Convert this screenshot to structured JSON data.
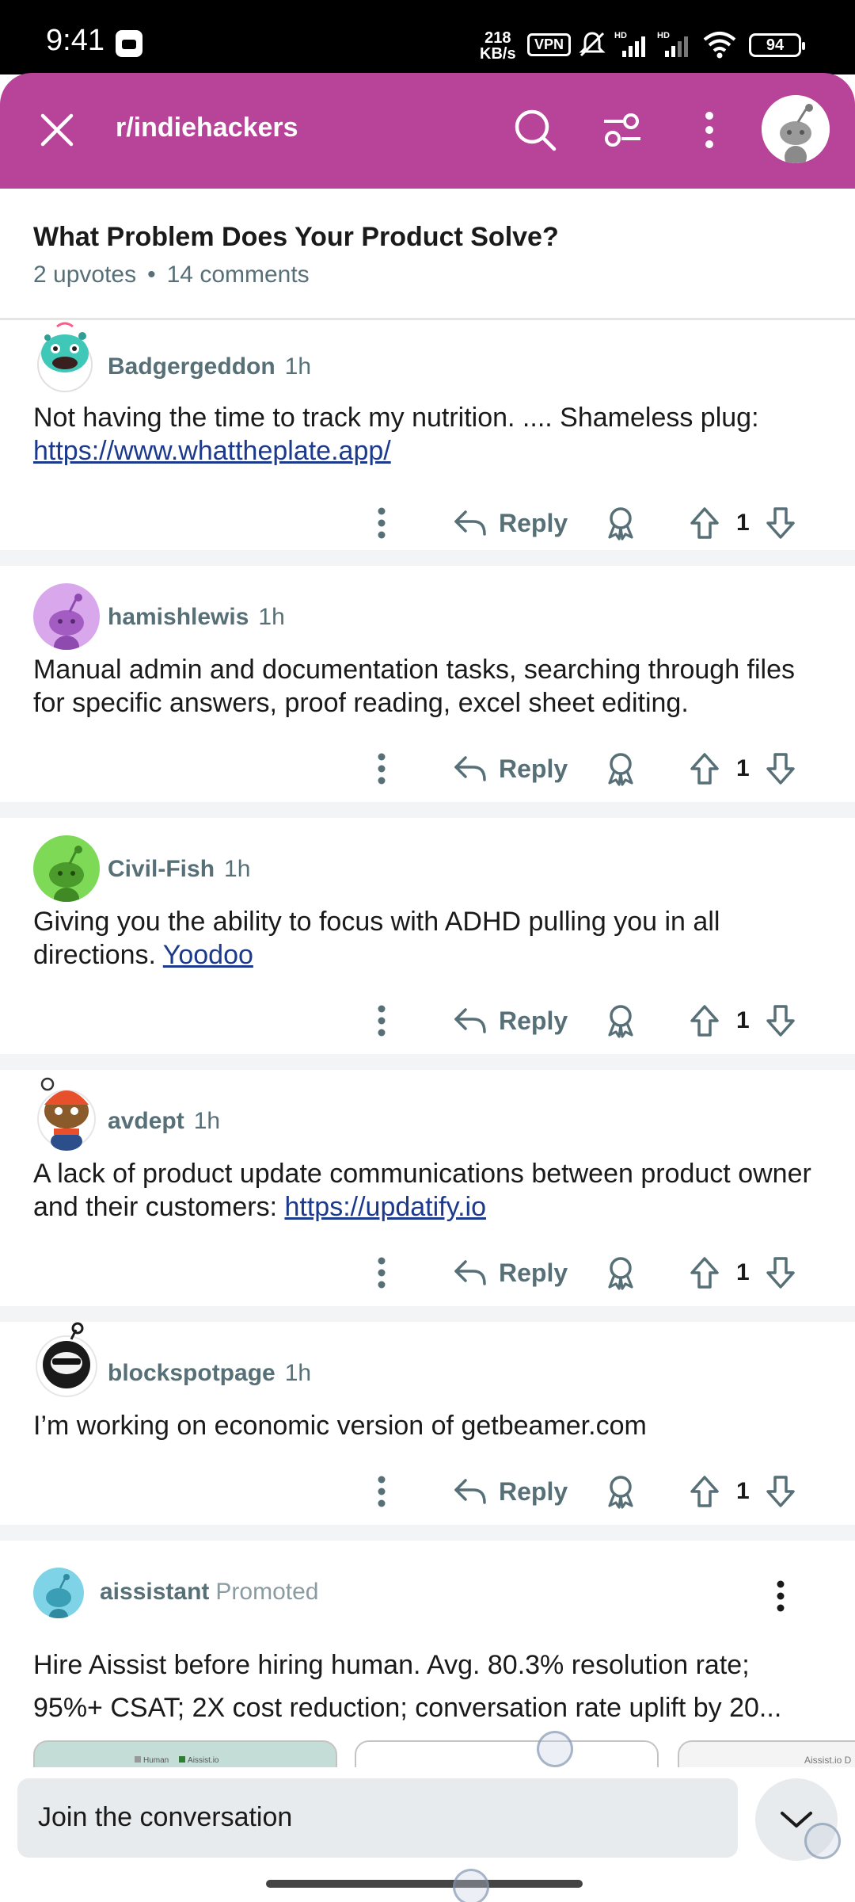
{
  "status_bar": {
    "time": "9:41",
    "net_speed_value": "218",
    "net_speed_unit": "KB/s",
    "vpn": "VPN",
    "battery": "94"
  },
  "header": {
    "subreddit": "r/indiehackers",
    "icons": [
      "close-icon",
      "search-icon",
      "filter-icon",
      "more-vertical-icon",
      "profile-avatar"
    ]
  },
  "post": {
    "title": "What Problem Does Your Product Solve?",
    "upvotes": "2 upvotes",
    "separator": "•",
    "comments": "14 comments"
  },
  "comments": [
    {
      "user": "Badgergeddon",
      "time": "1h",
      "body_text": "Not having the time to track my nutrition. .... Shameless plug: ",
      "link": "https://www.whattheplate.app/",
      "reply_label": "Reply",
      "votes": "1"
    },
    {
      "user": "hamishlewis",
      "time": "1h",
      "body_text": "Manual admin and documentation tasks, searching through files for specific answers, proof reading, excel sheet editing.",
      "link": "",
      "reply_label": "Reply",
      "votes": "1"
    },
    {
      "user": "Civil-Fish",
      "time": "1h",
      "body_text": "Giving you the ability to focus with ADHD pulling you in all directions. ",
      "link": "Yoodoo",
      "reply_label": "Reply",
      "votes": "1"
    },
    {
      "user": "avdept",
      "time": "1h",
      "body_text": "A lack of product update communications between product owner and their customers: ",
      "link": "https://updatify.io",
      "reply_label": "Reply",
      "votes": "1"
    },
    {
      "user": "blockspotpage",
      "time": "1h",
      "body_text": "I’m working on economic version of getbeamer.com",
      "link": "",
      "reply_label": "Reply",
      "votes": "1"
    }
  ],
  "promoted": {
    "user": "aissistant",
    "tag": "Promoted",
    "body_line1": "Hire Aissist before hiring human. Avg. 80.3% resolution rate;",
    "body_line2": "95%+ CSAT; 2X cost reduction; conversation rate uplift by 20...",
    "card1_legend_a": "Human",
    "card1_legend_b": "Aissist.io",
    "card3_label": "Aissist.io D"
  },
  "bottom_bar": {
    "placeholder": "Join the conversation"
  },
  "colors": {
    "header_bg": "#b8449a",
    "link": "#1c3a8c",
    "meta_text": "#576f76"
  }
}
